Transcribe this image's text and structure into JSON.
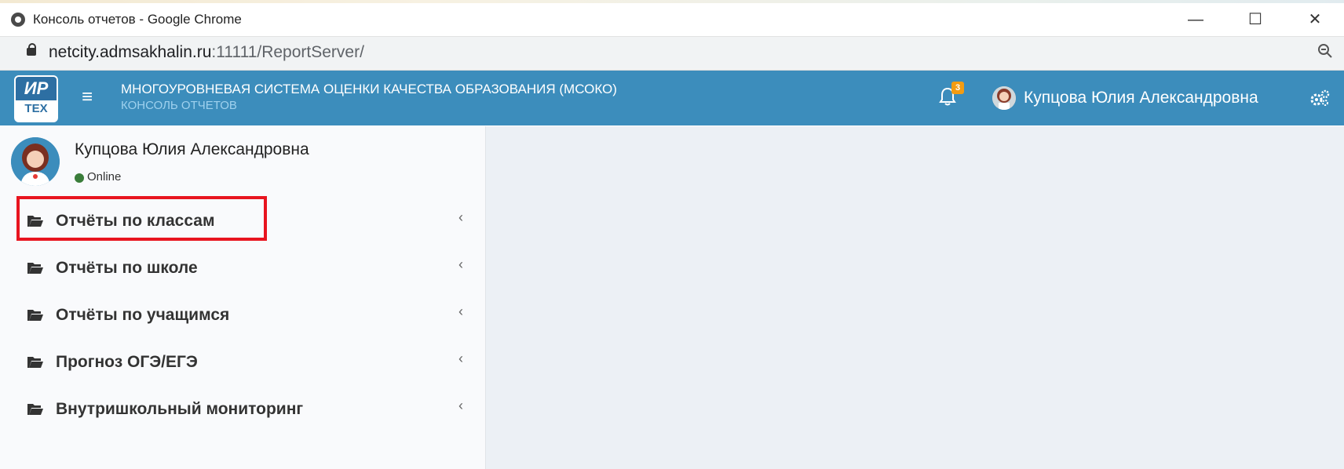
{
  "window": {
    "title": "Консоль отчетов - Google Chrome",
    "minimize": "—",
    "maximize": "☐",
    "close": "✕"
  },
  "address": {
    "host": "netcity.admsakhalin.ru",
    "path": ":11111/ReportServer/",
    "zoom_icon": "zoom-icon"
  },
  "header": {
    "logo_top": "ИР",
    "logo_bottom": "ТЕХ",
    "menu_glyph": "≡",
    "system_title": "МНОГОУРОВНЕВАЯ СИСТЕМА ОЦЕНКИ КАЧЕСТВА ОБРАЗОВАНИЯ (МСОКО)",
    "system_subtitle": "КОНСОЛЬ ОТЧЕТОВ",
    "notifications_count": "3",
    "user_name": "Купцова Юлия Александровна",
    "accent_color": "#3c8dbc",
    "badge_color": "#f39c12"
  },
  "sidebar": {
    "user_name": "Купцова Юлия Александровна",
    "status": "Online",
    "items": [
      {
        "label": "Отчёты по классам"
      },
      {
        "label": "Отчёты по школе"
      },
      {
        "label": "Отчёты по учащимся"
      },
      {
        "label": "Прогноз ОГЭ/ЕГЭ"
      },
      {
        "label": "Внутришкольный мониторинг"
      }
    ],
    "chevron": "‹",
    "highlight_color": "#e8141f"
  }
}
